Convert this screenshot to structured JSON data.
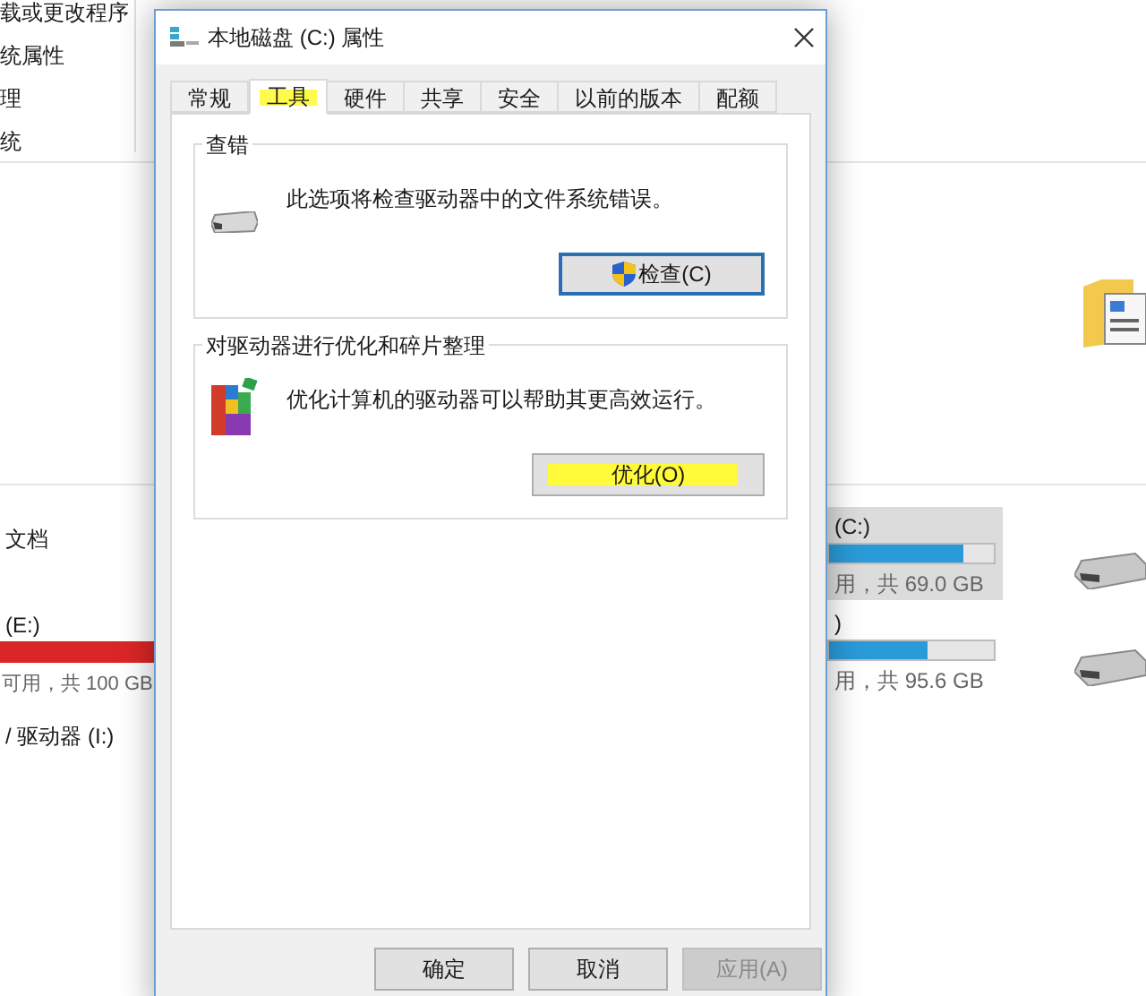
{
  "explorer": {
    "left_items": [
      "载或更改程序",
      "统属性",
      "理",
      "统"
    ],
    "left_drives": [
      {
        "label": "文档"
      },
      {
        "label": "(E:)",
        "level": 1.0,
        "color": "#da2626",
        "info": "可用，共 100 GB"
      },
      {
        "label": "/ 驱动器 (I:)"
      }
    ],
    "right_drives": [
      {
        "label": "(C:)",
        "selected": true,
        "level": 0.82,
        "color": "#2a9ad8",
        "info": "用，共 69.0 GB"
      },
      {
        "label": ")",
        "selected": false,
        "level": 0.6,
        "color": "#2a9ad8",
        "info": "用，共 95.6 GB"
      }
    ]
  },
  "dialog": {
    "title": "本地磁盘 (C:) 属性",
    "tabs": [
      {
        "label": "常规",
        "selected": false,
        "highlighted": false
      },
      {
        "label": "工具",
        "selected": true,
        "highlighted": true
      },
      {
        "label": "硬件",
        "selected": false,
        "highlighted": false
      },
      {
        "label": "共享",
        "selected": false,
        "highlighted": false
      },
      {
        "label": "安全",
        "selected": false,
        "highlighted": false
      },
      {
        "label": "以前的版本",
        "selected": false,
        "highlighted": false
      },
      {
        "label": "配额",
        "selected": false,
        "highlighted": false
      }
    ],
    "groups": [
      {
        "kind": "check",
        "title": "查错",
        "text": "此选项将检查驱动器中的文件系统错误。",
        "button": {
          "label": "检查(C)",
          "default": true,
          "highlighted": false
        }
      },
      {
        "kind": "optimize",
        "title": "对驱动器进行优化和碎片整理",
        "text": "优化计算机的驱动器可以帮助其更高效运行。",
        "button": {
          "label": "优化(O)",
          "default": false,
          "highlighted": true
        }
      }
    ],
    "buttons": [
      {
        "label": "确定",
        "disabled": false
      },
      {
        "label": "取消",
        "disabled": false
      },
      {
        "label": "应用(A)",
        "disabled": true
      }
    ]
  }
}
